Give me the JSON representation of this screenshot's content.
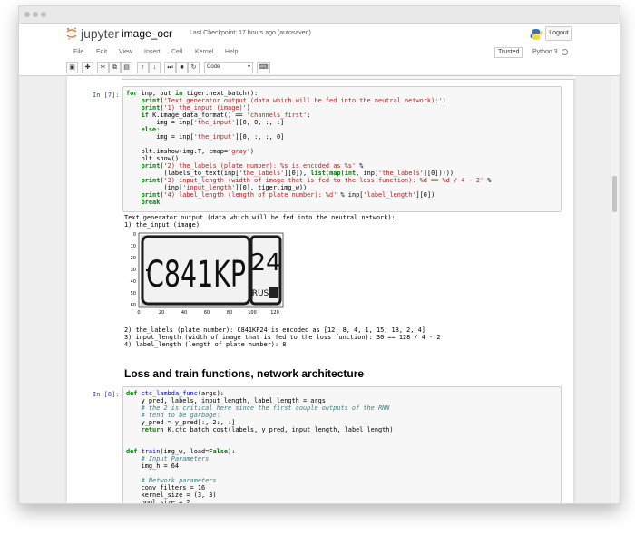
{
  "header": {
    "logo_text": "jupyter",
    "notebook_name": "image_ocr",
    "checkpoint": "Last Checkpoint: 17 hours ago (autosaved)",
    "logout": "Logout"
  },
  "menubar": {
    "items": [
      "File",
      "Edit",
      "View",
      "Insert",
      "Cell",
      "Kernel",
      "Help"
    ],
    "trusted": "Trusted",
    "kernel": "Python 3"
  },
  "toolbar": {
    "cell_type": "Code",
    "buttons": [
      "save-icon",
      "plus-icon",
      "cut-icon",
      "copy-icon",
      "paste-icon",
      "arrow-up-icon",
      "arrow-down-icon",
      "step-icon",
      "stop-icon",
      "restart-icon",
      "keyboard-icon"
    ]
  },
  "cells": {
    "cell1": {
      "prompt": "In [7]:",
      "output": [
        "Text generator output (data which will be fed into the neutral network):",
        "1) the_input (image)"
      ],
      "output2": [
        "2) the_labels (plate number): C841KP24 is encoded as [12, 8, 4, 1, 15, 18, 2, 4]",
        "3) input_length (width of image that is fed to the loss function): 30 == 128 / 4 - 2",
        "4) label_length (length of plate number): 8"
      ]
    },
    "heading": "Loss and train functions, network architecture",
    "cell2": {
      "prompt": "In [8]:"
    }
  },
  "plot": {
    "plate_text": "C841KP",
    "region_code": "24",
    "country": "RUS",
    "x_ticks": [
      "0",
      "20",
      "40",
      "60",
      "80",
      "100",
      "120"
    ],
    "y_ticks": [
      "0",
      "10",
      "20",
      "30",
      "40",
      "50",
      "60"
    ]
  }
}
